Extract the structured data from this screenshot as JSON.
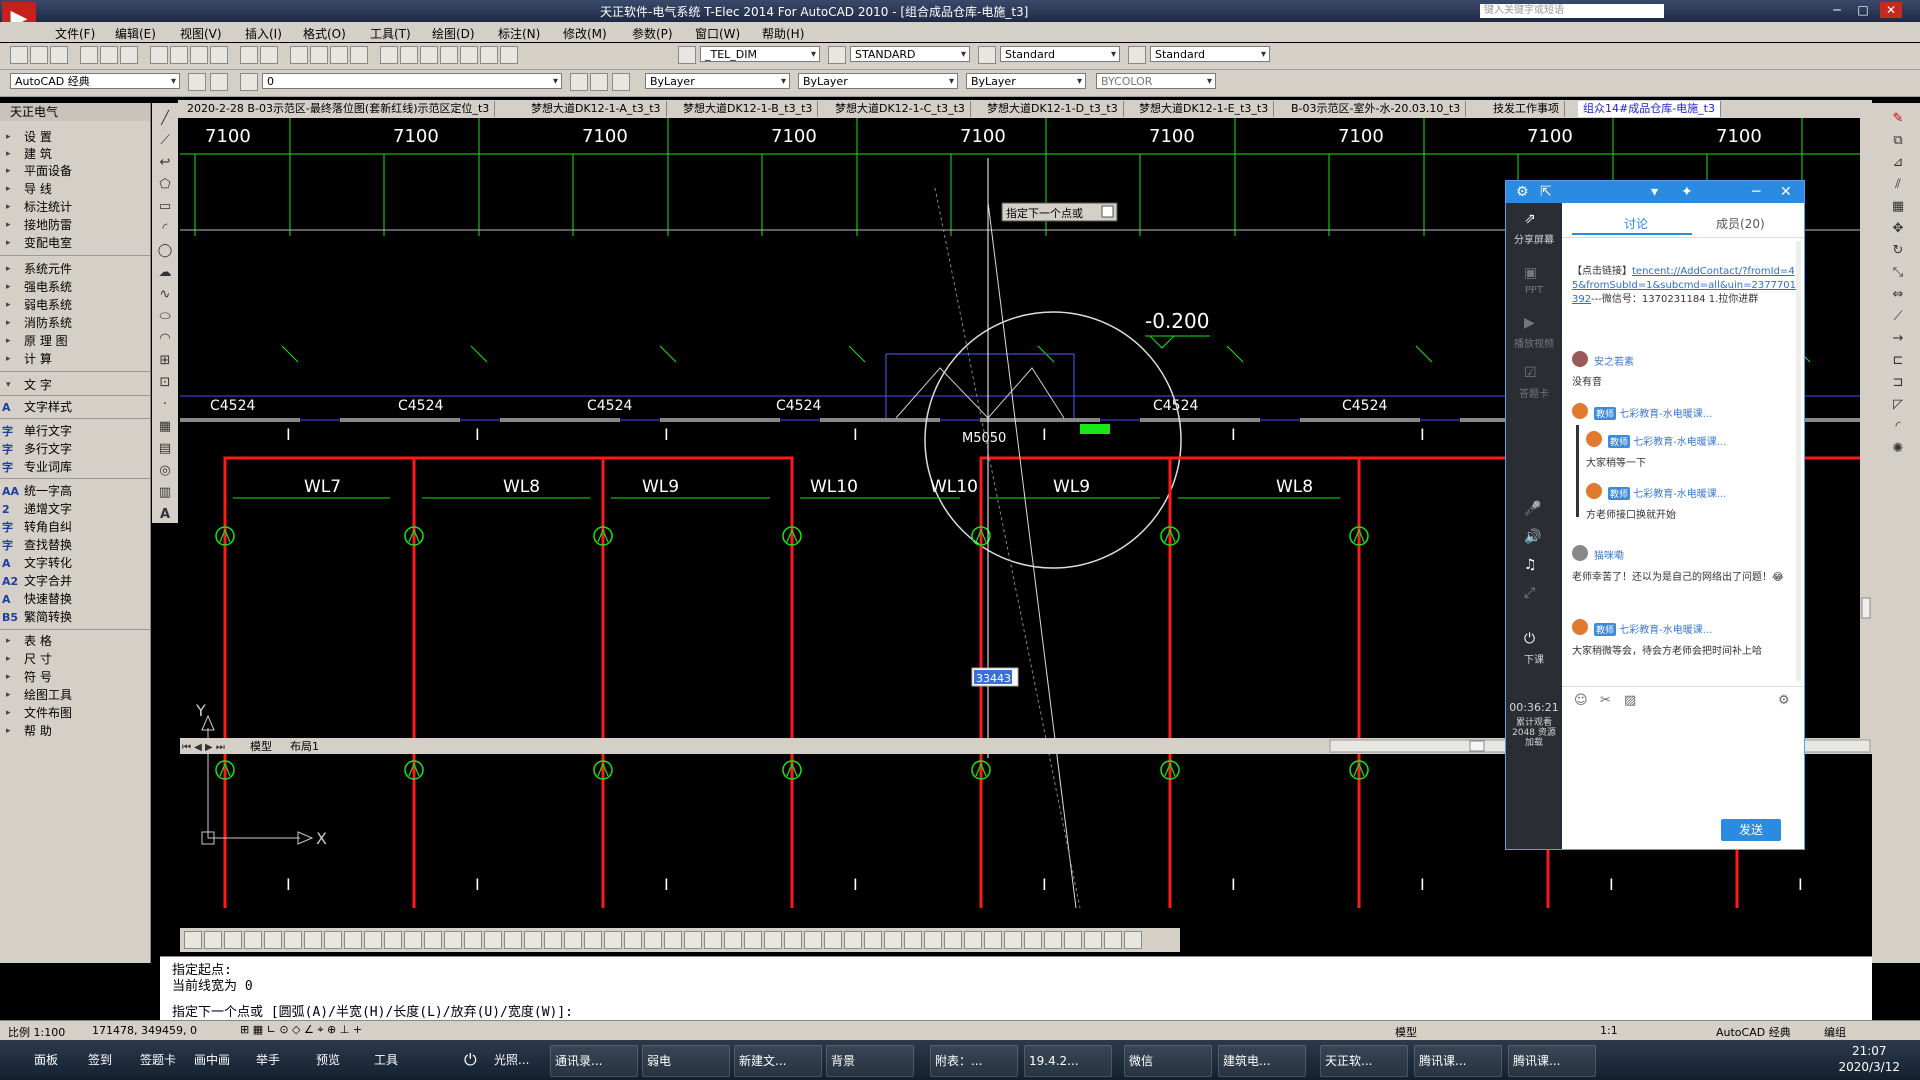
{
  "titlebar": {
    "title": "天正软件-电气系统 T-Elec 2014  For AutoCAD 2010 - [组合成品仓库-电施_t3]",
    "search_placeholder": "键入关键字或短语"
  },
  "menu": [
    "文件(F)",
    "编辑(E)",
    "视图(V)",
    "插入(I)",
    "格式(O)",
    "工具(T)",
    "绘图(D)",
    "标注(N)",
    "修改(M)",
    "参数(P)",
    "窗口(W)",
    "帮助(H)"
  ],
  "toolbar1": {
    "text_style": "_TEL_DIM",
    "dim_style": "STANDARD",
    "table_style": "Standard",
    "multileader_style": "Standard"
  },
  "toolbar2": {
    "workspace": "AutoCAD 经典",
    "layer": "0",
    "color": "ByLayer",
    "linetype": "ByLayer",
    "lineweight": "ByLayer",
    "plotstyle": "BYCOLOR"
  },
  "left_panel": {
    "header": "天正电气",
    "groups": [
      {
        "label": "设    置"
      },
      {
        "label": "建    筑"
      },
      {
        "label": "平面设备"
      },
      {
        "label": "导    线"
      },
      {
        "label": "标注统计"
      },
      {
        "label": "接地防雷"
      },
      {
        "label": "变配电室"
      }
    ],
    "groups2": [
      {
        "label": "系统元件"
      },
      {
        "label": "强电系统"
      },
      {
        "label": "弱电系统"
      },
      {
        "label": "消防系统"
      },
      {
        "label": "原 理 图"
      },
      {
        "label": "计    算"
      }
    ],
    "text_group": "文    字",
    "text_items": [
      {
        "icon": "A",
        "label": "文字样式"
      },
      {
        "icon": "字",
        "label": "单行文字"
      },
      {
        "icon": "字",
        "label": "多行文字"
      },
      {
        "icon": "字",
        "label": "专业词库"
      },
      {
        "icon": "AA",
        "label": "统一字高"
      },
      {
        "icon": "2",
        "label": "递增文字"
      },
      {
        "icon": "字",
        "label": "转角自纠"
      },
      {
        "icon": "字",
        "label": "查找替换"
      },
      {
        "icon": "A",
        "label": "文字转化"
      },
      {
        "icon": "A2",
        "label": "文字合并"
      },
      {
        "icon": "A",
        "label": "快速替换"
      },
      {
        "icon": "B5",
        "label": "繁简转换"
      }
    ],
    "groups3": [
      {
        "label": "表    格"
      },
      {
        "label": "尺    寸"
      },
      {
        "label": "符    号"
      },
      {
        "label": "绘图工具"
      },
      {
        "label": "文件布图"
      },
      {
        "label": "帮    助"
      }
    ]
  },
  "drawing_tabs": [
    "2020-2-28 B-03示范区-最终落位图(套新红线)示范区定位_t3",
    "梦想大道DK12-1-A_t3_t3",
    "梦想大道DK12-1-B_t3_t3",
    "梦想大道DK12-1-C_t3_t3",
    "梦想大道DK12-1-D_t3_t3",
    "梦想大道DK12-1-E_t3_t3",
    "B-03示范区-室外-水-20.03.10_t3",
    "技发工作事项",
    "组众14#成品仓库-电施_t3"
  ],
  "drawing": {
    "dimensions": [
      "7100",
      "7100",
      "7100",
      "7100",
      "7100",
      "7100",
      "7100",
      "7100",
      "7100"
    ],
    "windows": [
      "C4524",
      "C4524",
      "C4524",
      "C4524",
      "C4524",
      "C4524"
    ],
    "door_label": "M5050",
    "elevation": "-0.200",
    "circuits": [
      "WL7",
      "WL8",
      "WL9",
      "WL10",
      "WL10",
      "WL9",
      "WL8"
    ],
    "tooltip": "指定下一个点或",
    "dyn_input": "33443",
    "axis_x": "X",
    "axis_y": "Y"
  },
  "layout_tabs": [
    "模型",
    "布局1"
  ],
  "chat": {
    "tab_discuss": "讨论",
    "tab_members": "成员(20)",
    "side_share": "分享屏幕",
    "side_ppt": "PPT",
    "side_play": "播放视频",
    "side_ask": "答题卡",
    "side_leave": "下课",
    "timer": "00:36:21",
    "resource": "累计观看 2048 资源加载",
    "link_msg_prefix": "【点击链接】",
    "link_msg_url": "tencent://AddContact/?fromId=45&fromSubId=1&subcmd=all&uin=2377701392",
    "link_msg_suffix": "---微信号：1370231184 1.拉你进群",
    "messages": [
      {
        "name": "安之若素",
        "teacher": false,
        "text": "没有音"
      },
      {
        "name": "七彩教育-水电暖课...",
        "teacher": true,
        "text": ""
      },
      {
        "name": "七彩教育-水电暖课...",
        "teacher": true,
        "text": "大家稍等一下"
      },
      {
        "name": "七彩教育-水电暖课...",
        "teacher": true,
        "text": "方老师接口换就开始"
      },
      {
        "name": "猫咪嘞",
        "teacher": false,
        "text": "老师幸苦了！还以为是自己的网络出了问题！😂"
      },
      {
        "name": "七彩教育-水电暖课...",
        "teacher": true,
        "text": "大家稍微等会，待会方老师会把时间补上哈"
      }
    ],
    "teacher_badge": "教师",
    "send": "发送"
  },
  "command": {
    "line1": "指定起点:",
    "line2": "当前线宽为 0",
    "line3": "指定下一个点或 [圆弧(A)/半宽(H)/长度(L)/放弃(U)/宽度(W)]:"
  },
  "status": {
    "scale": "比例 1:100",
    "coords": "171478, 349459, 0",
    "model": "模型",
    "annot_scale": "1:1",
    "workspace": "AutoCAD 经典",
    "edit": "编组"
  },
  "taskbar": {
    "items": [
      "面板",
      "签到",
      "签题卡",
      "画中画",
      "举手",
      "预览",
      "工具"
    ],
    "apps": [
      "光照...",
      "通讯录...",
      "弱电",
      "新建文...",
      "背景",
      "附表：...",
      "19.4.2...",
      "微信",
      "建筑电...",
      "天正软...",
      "腾讯课...",
      "腾讯课..."
    ],
    "time": "21:07",
    "date": "2020/3/12"
  },
  "colors": {
    "grid_green": "#17e617",
    "wire_red": "#ff1a1a",
    "chat_blue": "#2b8be0"
  }
}
